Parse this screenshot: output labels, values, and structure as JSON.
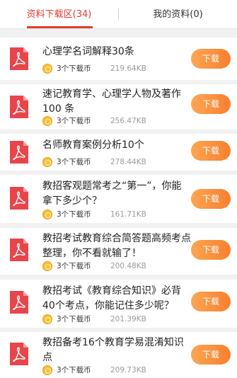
{
  "tabs": {
    "download_area": "资料下载区(34)",
    "my_materials": "我的资料(0)"
  },
  "colors": {
    "accent": "#e03c2f",
    "button_gradient_start": "#fda653",
    "button_gradient_end": "#f77f2e",
    "pdf_icon": "#e8454a",
    "coin": "#f8c13a"
  },
  "icons": {
    "file": "pdf-file-icon",
    "coin": "coin-icon"
  },
  "items": [
    {
      "title": "心理学名词解释30条",
      "coins": "3个下载币",
      "size": "219.64KB",
      "button": "下载"
    },
    {
      "title": "速记教育学、心理学人物及著作100 条",
      "coins": "3个下载币",
      "size": "256.47KB",
      "button": "下载"
    },
    {
      "title": "名师教育案例分析10个",
      "coins": "3个下载币",
      "size": "278.44KB",
      "button": "下载"
    },
    {
      "title": "教招客观题常考之“第一”，你能拿下多少个？",
      "coins": "3个下载币",
      "size": "161.71KB",
      "button": "下载"
    },
    {
      "title": "教招考试教育综合简答题高频考点整理，你不看就输了！",
      "coins": "3个下载币",
      "size": "200.48KB",
      "button": "下载"
    },
    {
      "title": "教招考试《教育综合知识》必背40个考点，你能记住多少呢？",
      "coins": "3个下载币",
      "size": "201.39KB",
      "button": "下载"
    },
    {
      "title": "教招备考16个教育学易混淆知识点",
      "coins": "3个下载币",
      "size": "209.73KB",
      "button": "下载"
    }
  ]
}
